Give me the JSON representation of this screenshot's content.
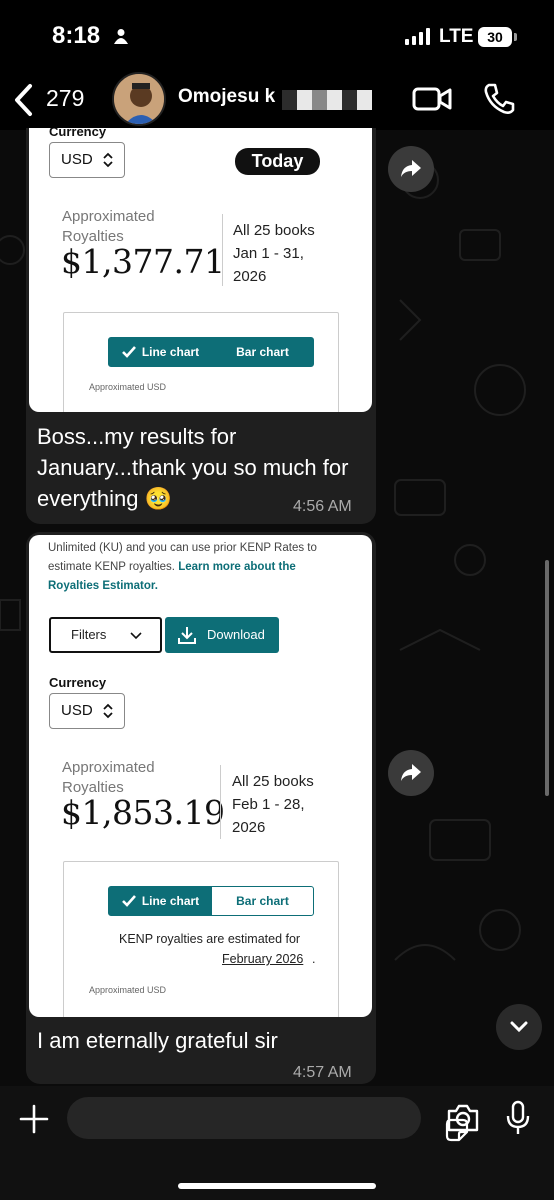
{
  "status_bar": {
    "time": "8:18",
    "network": "LTE",
    "battery": "30"
  },
  "chat_header": {
    "unread_count": "279",
    "contact_name": "Omojesu k"
  },
  "messages": [
    {
      "screenshot": {
        "currency_label": "Currency",
        "currency_value": "USD",
        "period_chip": "Today",
        "approx_label": "Approximated Royalties",
        "amount": "$1,377.71",
        "books": "All 25 books",
        "date_range": "Jan 1 - 31, 2026",
        "toggle_line": "Line chart",
        "toggle_bar": "Bar chart",
        "chart_caption": "Approximated USD"
      },
      "text": "Boss...my results for January...thank you so much for everything",
      "emoji": "🥹",
      "time": "4:56 AM"
    },
    {
      "screenshot": {
        "intro_text": "Unlimited (KU) and you can use prior KENP Rates to estimate KENP royalties.",
        "intro_link": "Learn more about the Royalties Estimator.",
        "filters_label": "Filters",
        "download_label": "Download",
        "currency_label": "Currency",
        "currency_value": "USD",
        "approx_label": "Approximated Royalties",
        "amount": "$1,853.19",
        "books": "All 25 books",
        "date_range": "Feb 1 - 28, 2026",
        "toggle_line": "Line chart",
        "toggle_bar": "Bar chart",
        "kenp_note": "KENP royalties are estimated for",
        "kenp_month": "February 2026",
        "chart_caption": "Approximated USD"
      },
      "text": "I am eternally grateful sir",
      "time": "4:57 AM"
    }
  ],
  "colors": {
    "accent_teal": "#0d6e77",
    "bubble": "#1f1f1f",
    "background": "#0b0b0b"
  }
}
